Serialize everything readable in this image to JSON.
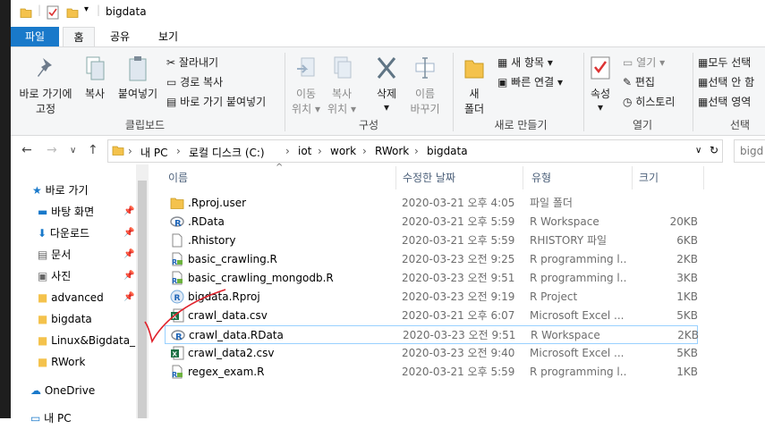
{
  "window": {
    "title": "bigdata"
  },
  "tabs": {
    "file": "파일",
    "home": "홈",
    "share": "공유",
    "view": "보기"
  },
  "ribbon": {
    "pin_quick": [
      "바로 가기에",
      "고정"
    ],
    "copy": "복사",
    "paste": "붙여넣기",
    "cut": "잘라내기",
    "copy_path": "경로 복사",
    "paste_shortcut": "바로 가기 붙여넣기",
    "group_clipboard": "클립보드",
    "move_to": [
      "이동",
      "위치"
    ],
    "copy_to": [
      "복사",
      "위치"
    ],
    "delete": "삭제",
    "rename": [
      "이름",
      "바꾸기"
    ],
    "group_organize": "구성",
    "new_folder": [
      "새",
      "폴더"
    ],
    "new_item": "새 항목",
    "easy_access": "빠른 연결",
    "group_new": "새로 만들기",
    "properties": "속성",
    "open": "열기",
    "edit": "편집",
    "history": "히스토리",
    "group_open": "열기",
    "select_all": "모두 선택",
    "select_none": "선택 안 함",
    "invert_selection": "선택 영역",
    "group_select": "선택"
  },
  "address": {
    "crumbs": [
      "내 PC",
      "로컬 디스크 (C:)",
      "iot",
      "work",
      "RWork",
      "bigdata"
    ],
    "search_placeholder": "bigd"
  },
  "nav": {
    "items": [
      {
        "label": "바로 가기",
        "icon": "star-icon",
        "pinned": false
      },
      {
        "label": "바탕 화면",
        "icon": "desktop-icon",
        "pinned": true
      },
      {
        "label": "다운로드",
        "icon": "download-icon",
        "pinned": true
      },
      {
        "label": "문서",
        "icon": "document-icon",
        "pinned": true
      },
      {
        "label": "사진",
        "icon": "picture-icon",
        "pinned": true
      },
      {
        "label": "advanced",
        "icon": "folder-icon",
        "pinned": true
      },
      {
        "label": "bigdata",
        "icon": "folder-icon",
        "pinned": false
      },
      {
        "label": "Linux&Bigdata_r",
        "icon": "folder-icon",
        "pinned": false
      },
      {
        "label": "RWork",
        "icon": "folder-icon",
        "pinned": false
      },
      {
        "label": "OneDrive",
        "icon": "cloud-icon",
        "pinned": false
      },
      {
        "label": "내 PC",
        "icon": "pc-icon",
        "pinned": false
      }
    ]
  },
  "columns": {
    "name": "이름",
    "date": "수정한 날짜",
    "type": "유형",
    "size": "크기"
  },
  "files": [
    {
      "name": ".Rproj.user",
      "date": "2020-03-21 오후 4:05",
      "type": "파일 폴더",
      "size": "",
      "icon": "folder-icon"
    },
    {
      "name": ".RData",
      "date": "2020-03-21 오후 5:59",
      "type": "R Workspace",
      "size": "20KB",
      "icon": "r-logo-icon"
    },
    {
      "name": ".Rhistory",
      "date": "2020-03-21 오후 5:59",
      "type": "RHISTORY 파일",
      "size": "6KB",
      "icon": "blank-file-icon"
    },
    {
      "name": "basic_crawling.R",
      "date": "2020-03-23 오전 9:25",
      "type": "R programming l...",
      "size": "2KB",
      "icon": "r-script-icon"
    },
    {
      "name": "basic_crawling_mongodb.R",
      "date": "2020-03-23 오전 9:51",
      "type": "R programming l...",
      "size": "3KB",
      "icon": "r-script-icon"
    },
    {
      "name": "bigdata.Rproj",
      "date": "2020-03-23 오전 9:19",
      "type": "R Project",
      "size": "1KB",
      "icon": "rproj-icon"
    },
    {
      "name": "crawl_data.csv",
      "date": "2020-03-21 오후 6:07",
      "type": "Microsoft Excel ...",
      "size": "5KB",
      "icon": "excel-icon"
    },
    {
      "name": "crawl_data.RData",
      "date": "2020-03-23 오전 9:51",
      "type": "R Workspace",
      "size": "2KB",
      "icon": "r-logo-icon"
    },
    {
      "name": "crawl_data2.csv",
      "date": "2020-03-23 오전 9:40",
      "type": "Microsoft Excel ...",
      "size": "5KB",
      "icon": "excel-icon"
    },
    {
      "name": "regex_exam.R",
      "date": "2020-03-21 오후 5:59",
      "type": "R programming l...",
      "size": "1KB",
      "icon": "r-script-icon"
    }
  ],
  "colors": {
    "accent": "#1979ca",
    "selection_border": "#99d1ff",
    "annotation": "#e0202a",
    "folder": "#f4c24c"
  }
}
